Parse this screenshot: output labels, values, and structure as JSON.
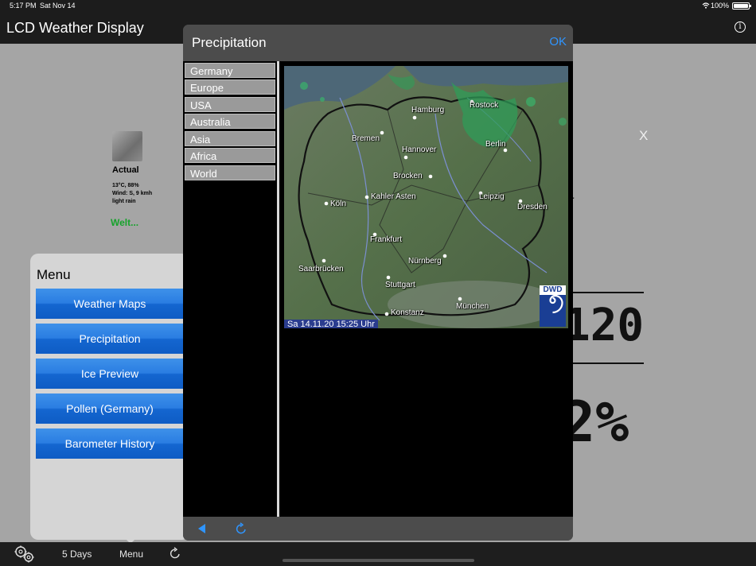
{
  "status_bar": {
    "time": "5:17 PM",
    "date": "Sat Nov 14",
    "battery": "100%"
  },
  "app": {
    "title": "LCD Weather Display"
  },
  "background": {
    "actual_title": "Actual",
    "actual_line1": "13°C, 88%",
    "actual_line2": "Wind: S, 9 kmh",
    "actual_line3": "light rain",
    "actual_link": "Welt...",
    "close_label": "X",
    "fragment_text": "ar",
    "lcd_value_1": "120",
    "lcd_value_2": "2%"
  },
  "menu": {
    "title": "Menu",
    "items": [
      {
        "label": "Weather Maps"
      },
      {
        "label": "Precipitation"
      },
      {
        "label": "Ice Preview"
      },
      {
        "label": "Pollen (Germany)"
      },
      {
        "label": "Barometer History"
      }
    ]
  },
  "tabbar": {
    "five_days": "5 Days",
    "menu": "Menu"
  },
  "modal": {
    "title": "Precipitation",
    "ok_label": "OK",
    "regions": [
      {
        "label": "Germany"
      },
      {
        "label": "Europe"
      },
      {
        "label": "USA"
      },
      {
        "label": "Australia"
      },
      {
        "label": "Asia"
      },
      {
        "label": "Africa"
      },
      {
        "label": "World"
      }
    ],
    "map": {
      "cities": [
        {
          "name": "Hamburg"
        },
        {
          "name": "Rostock"
        },
        {
          "name": "Bremen"
        },
        {
          "name": "Berlin"
        },
        {
          "name": "Hannover"
        },
        {
          "name": "Brocken"
        },
        {
          "name": "Kahler Asten"
        },
        {
          "name": "Leipzig"
        },
        {
          "name": "Köln"
        },
        {
          "name": "Dresden"
        },
        {
          "name": "Frankfurt"
        },
        {
          "name": "Saarbrücken"
        },
        {
          "name": "Nürnberg"
        },
        {
          "name": "Stuttgart"
        },
        {
          "name": "München"
        },
        {
          "name": "Konstanz"
        }
      ],
      "timestamp": "Sa 14.11.20  15:25 Uhr",
      "logo_text": "DWD"
    }
  },
  "colors": {
    "accent": "#2f95ff",
    "menu_button": "#1f73dc",
    "link_green": "#16a32b"
  }
}
